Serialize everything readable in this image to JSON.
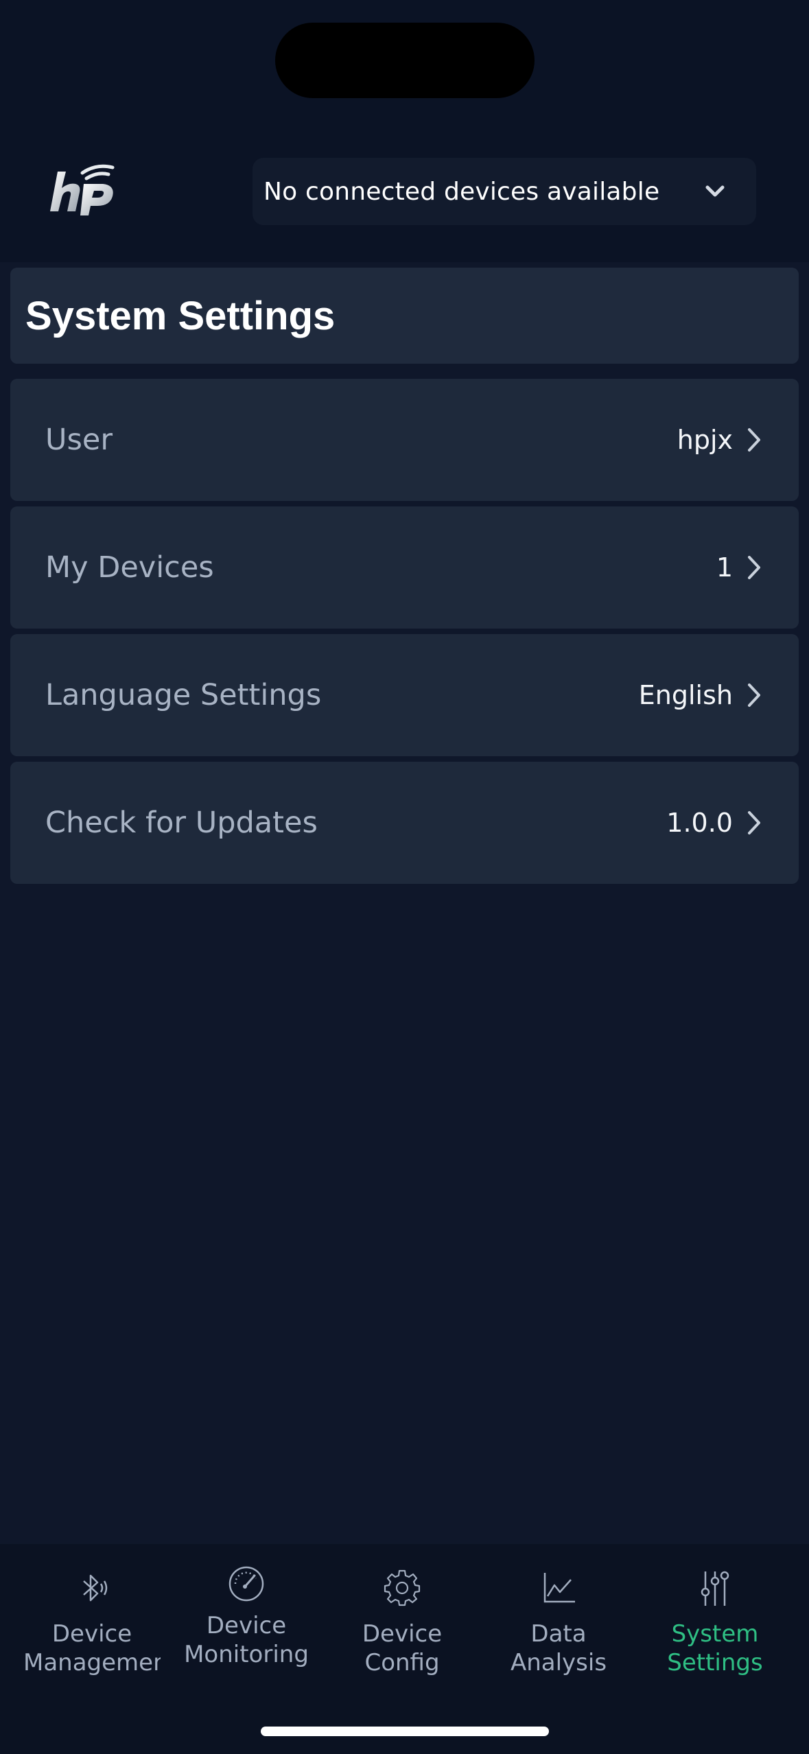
{
  "header": {
    "device_select_text": "No connected devices available",
    "logo_icon": "hp-wifi-logo-icon",
    "chevron_icon": "chevron-down-icon"
  },
  "page": {
    "title": "System Settings"
  },
  "settings": [
    {
      "label": "User",
      "value": "hpjx"
    },
    {
      "label": "My Devices",
      "value": "1"
    },
    {
      "label": "Language Settings",
      "value": "English"
    },
    {
      "label": "Check for Updates",
      "value": "1.0.0"
    }
  ],
  "tabs": [
    {
      "line1": "Device",
      "line2": "Management",
      "icon": "bluetooth-icon"
    },
    {
      "line1": "Device",
      "line2": "Monitoring",
      "icon": "gauge-icon"
    },
    {
      "line1": "Device",
      "line2": "Config",
      "icon": "gear-icon"
    },
    {
      "line1": "Data",
      "line2": "Analysis",
      "icon": "line-chart-icon"
    },
    {
      "line1": "System",
      "line2": "Settings",
      "icon": "sliders-icon",
      "active": true
    }
  ],
  "colors": {
    "accent": "#2fbf84",
    "background": "#0f172a",
    "card": "#1e293b"
  }
}
